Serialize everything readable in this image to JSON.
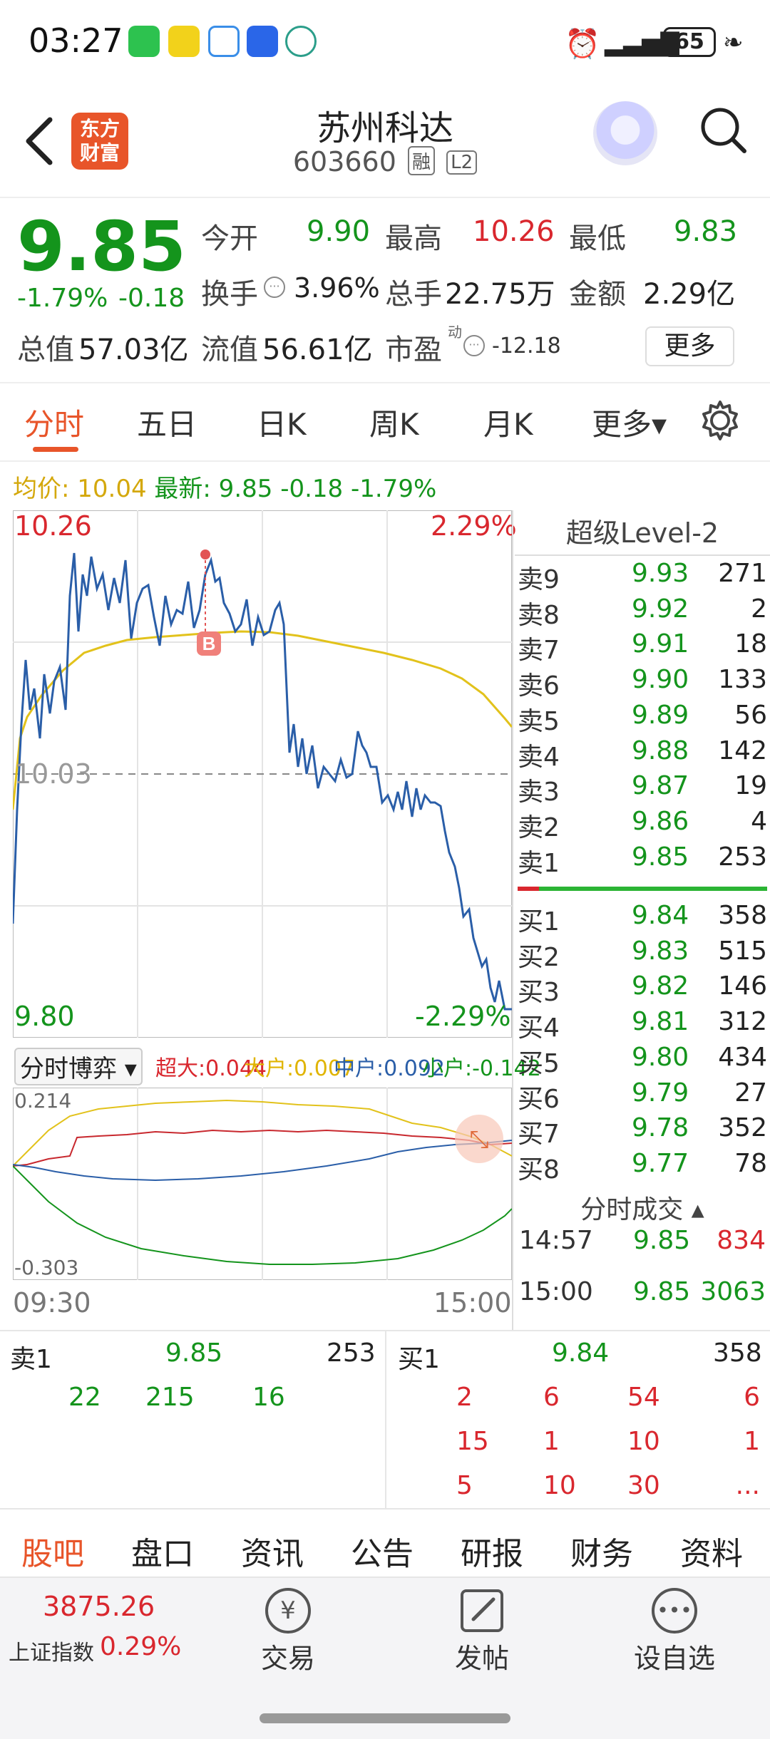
{
  "status_bar": {
    "time": "03:27",
    "battery": "65"
  },
  "header": {
    "back_icon": "chevron-left-icon",
    "logo_text": "东方\n财富",
    "stock_name": "苏州科达",
    "stock_code": "603660",
    "tag_margin": "融",
    "tag_level": "L2",
    "search_icon": "search-icon"
  },
  "quote": {
    "price": "9.85",
    "change_pct": "-1.79%",
    "change": "-0.18",
    "open_label": "今开",
    "open": "9.90",
    "high_label": "最高",
    "high": "10.26",
    "low_label": "最低",
    "low": "9.83",
    "turnover_label": "换手",
    "turnover": "3.96%",
    "volume_label": "总手",
    "volume": "22.75万",
    "amount_label": "金额",
    "amount": "2.29亿",
    "mktcap_label": "总值",
    "mktcap": "57.03亿",
    "float_label": "流值",
    "float_cap": "56.61亿",
    "pe_label": "市盈",
    "pe_sup": "动",
    "pe": "-12.18",
    "more_button": "更多"
  },
  "tabs": [
    "分时",
    "五日",
    "日K",
    "周K",
    "月K",
    "更多▾"
  ],
  "intraday": {
    "avg_label": "均价: 10.04",
    "latest_label": "最新: 9.85 -0.18 -1.79%",
    "y_top": "10.26",
    "y_top_pct": "2.29%",
    "y_mid": "10.03",
    "y_bottom": "9.80",
    "y_bottom_pct": "-2.29%",
    "marker": "B"
  },
  "game_panel": {
    "selector": "分时博弈 ▾",
    "super_label": "超大:0.044",
    "large_label": "大户:0.007",
    "mid_label": "中户:0.092",
    "small_label": "小户:-0.142",
    "y_top": "0.214",
    "y_bottom": "-0.303",
    "x_start": "09:30",
    "x_end": "15:00"
  },
  "order_book": {
    "title": "超级Level-2",
    "asks": [
      {
        "label": "卖9",
        "price": "9.93",
        "vol": "271"
      },
      {
        "label": "卖8",
        "price": "9.92",
        "vol": "2"
      },
      {
        "label": "卖7",
        "price": "9.91",
        "vol": "18"
      },
      {
        "label": "卖6",
        "price": "9.90",
        "vol": "133"
      },
      {
        "label": "卖5",
        "price": "9.89",
        "vol": "56"
      },
      {
        "label": "卖4",
        "price": "9.88",
        "vol": "142"
      },
      {
        "label": "卖3",
        "price": "9.87",
        "vol": "19"
      },
      {
        "label": "卖2",
        "price": "9.86",
        "vol": "4"
      },
      {
        "label": "卖1",
        "price": "9.85",
        "vol": "253"
      }
    ],
    "bids": [
      {
        "label": "买1",
        "price": "9.84",
        "vol": "358"
      },
      {
        "label": "买2",
        "price": "9.83",
        "vol": "515"
      },
      {
        "label": "买3",
        "price": "9.82",
        "vol": "146"
      },
      {
        "label": "买4",
        "price": "9.81",
        "vol": "312"
      },
      {
        "label": "买5",
        "price": "9.80",
        "vol": "434"
      },
      {
        "label": "买6",
        "price": "9.79",
        "vol": "27"
      },
      {
        "label": "买7",
        "price": "9.78",
        "vol": "352"
      },
      {
        "label": "买8",
        "price": "9.77",
        "vol": "78"
      }
    ],
    "trades_title": "分时成交 ▴",
    "trades": [
      {
        "time": "14:57",
        "price": "9.85",
        "vol": "834"
      },
      {
        "time": "15:00",
        "price": "9.85",
        "vol": "3063"
      }
    ]
  },
  "mini_book": {
    "sell_label": "卖1",
    "sell_price": "9.85",
    "sell_vol": "253",
    "sell_queue": [
      "22",
      "215",
      "16"
    ],
    "buy_label": "买1",
    "buy_price": "9.84",
    "buy_vol": "358",
    "buy_queue": [
      [
        "2",
        "6",
        "54",
        "6"
      ],
      [
        "15",
        "1",
        "10",
        "1"
      ],
      [
        "5",
        "10",
        "30",
        "..."
      ]
    ]
  },
  "bottom_tabs": [
    "股吧",
    "盘口",
    "资讯",
    "公告",
    "研报",
    "财务",
    "资料"
  ],
  "bottom_bar": {
    "index_value": "3875.26",
    "index_name": "上证指数",
    "index_pct": "0.29%",
    "trade_label": "交易",
    "post_label": "发帖",
    "watch_label": "设自选"
  },
  "colors": {
    "up": "#d9272e",
    "down": "#14941c",
    "price_line": "#2a5ea8",
    "avg_line": "#e2c21b",
    "accent": "#e8552a"
  }
}
